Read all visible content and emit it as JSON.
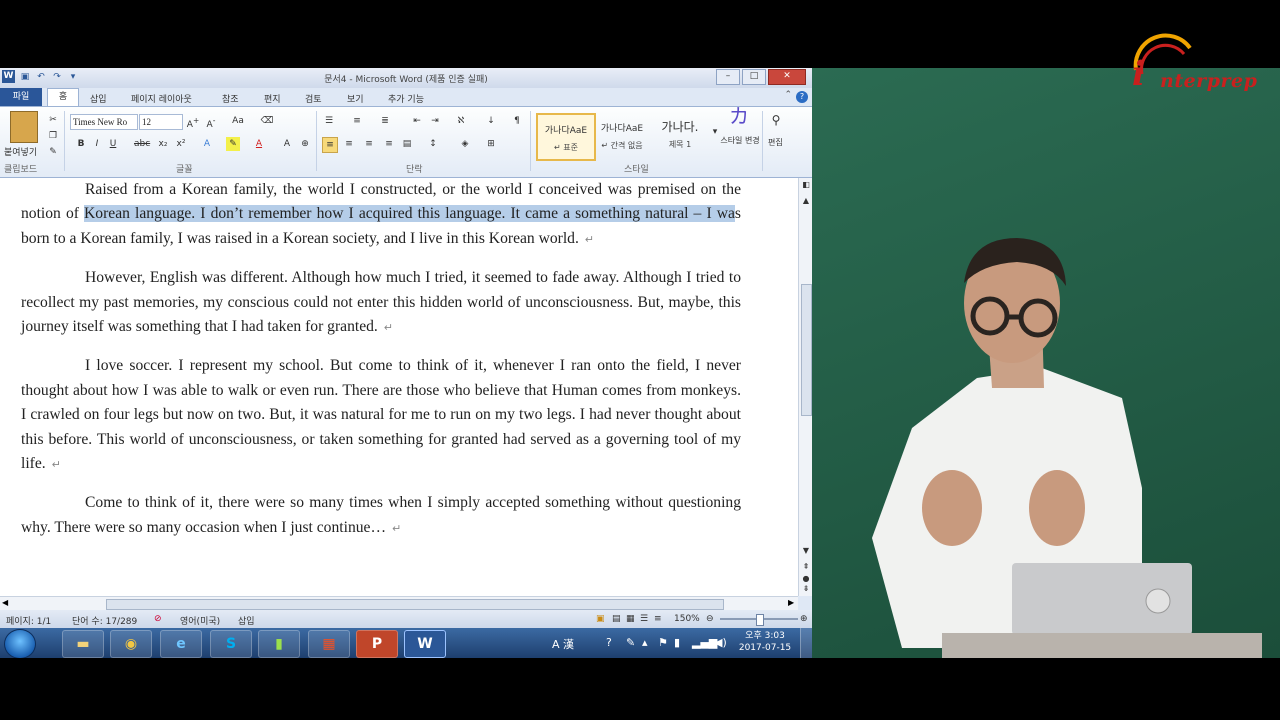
{
  "window": {
    "title": "문서4 - Microsoft Word (제품 인증 실패)"
  },
  "tabs": {
    "file": "파일",
    "items": [
      "홈",
      "삽입",
      "페이지 레이아웃",
      "참조",
      "편지",
      "검토",
      "보기",
      "추가 기능"
    ]
  },
  "ribbon": {
    "clipboard": {
      "paste": "붙여넣기",
      "label": "클립보드"
    },
    "font": {
      "name": "Times New Ro",
      "size": "12",
      "label": "글꼴",
      "change_case": "Aa"
    },
    "paragraph": {
      "label": "단락"
    },
    "styles": {
      "label": "스타일",
      "items": [
        {
          "sample": "가나다AaE",
          "name": "↵ 표준"
        },
        {
          "sample": "가나다AaE",
          "name": "↵ 간격 없음"
        },
        {
          "sample": "가나다.",
          "name": "제목 1"
        }
      ],
      "change": "스타일 변경"
    },
    "editing": {
      "label": "편집"
    }
  },
  "document": {
    "p1_before": "Raised from a Korean family, the world I constructed, or the world I conceived was premised on the notion of ",
    "p1_selected": "Korean language. I don’t remember how I acquired this language. It came a something natural – I wa",
    "p1_after": "s born to a Korean family, I was raised in a Korean society, and I live in this Korean world.",
    "p2": "However, English was different. Although how much I tried, it seemed to fade away. Although I tried to recollect my past memories, my conscious could not enter this hidden world of unconsciousness. But, maybe, this journey itself was something that I had taken for granted.",
    "p3": "I love soccer. I represent my school. But come to think of it, whenever I ran onto the field, I never thought about how I was able to walk or even run. There are those who believe that Human comes from monkeys. I crawled on four legs but now on two. But, it was natural for me to run on my two legs. I had never thought about this before. This world of unconsciousness, or taken something for granted had served as a governing tool of my life.",
    "p4": "Come to think of it, there were so many times when I simply accepted something without questioning why. There were so many occasion when I just continue…",
    "pilcrow": "↵"
  },
  "statusbar": {
    "page": "페이지: 1/1",
    "words": "단어 수: 17/289",
    "language": "영어(미국)",
    "mode": "삽입",
    "zoom": "150%"
  },
  "taskbar": {
    "ime": "A 漢",
    "time": "오후 3:03",
    "date": "2017-07-15"
  },
  "video": {
    "logo_text": "nterprep",
    "logo_initial": "i"
  }
}
